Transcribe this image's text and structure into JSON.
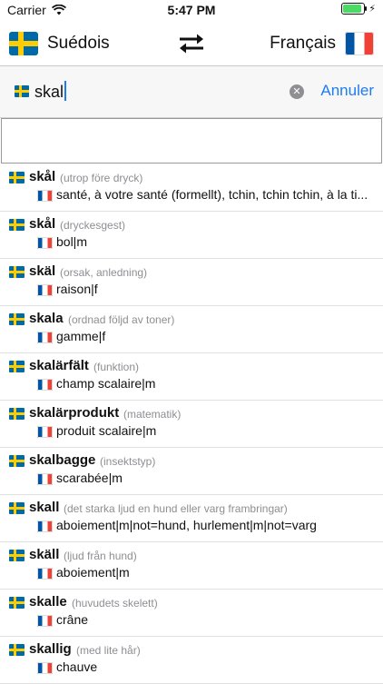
{
  "status_bar": {
    "carrier": "Carrier",
    "time": "5:47 PM",
    "icons": [
      "wifi-icon",
      "battery-icon",
      "charging-icon"
    ]
  },
  "language_bar": {
    "source_language": "Suédois",
    "target_language": "Français",
    "icons": [
      "flag-se-icon",
      "swap-icon",
      "flag-fr-icon"
    ]
  },
  "search": {
    "value": "skal",
    "cancel_label": "Annuler",
    "icons": [
      "flag-se-icon",
      "clear-icon"
    ]
  },
  "results": [
    {
      "word": "skål",
      "note": "(utrop före dryck)",
      "translation": "santé, à votre santé (formellt), tchin, tchin tchin, à la ti..."
    },
    {
      "word": "skål",
      "note": "(dryckesgest)",
      "translation": "bol|m"
    },
    {
      "word": "skäl",
      "note": "(orsak, anledning)",
      "translation": "raison|f"
    },
    {
      "word": "skala",
      "note": "(ordnad följd av toner)",
      "translation": "gamme|f"
    },
    {
      "word": "skalärfält",
      "note": "(funktion)",
      "translation": "champ scalaire|m"
    },
    {
      "word": "skalärprodukt",
      "note": "(matematik)",
      "translation": "produit scalaire|m"
    },
    {
      "word": "skalbagge",
      "note": "(insektstyp)",
      "translation": "scarabée|m"
    },
    {
      "word": "skall",
      "note": "(det starka ljud en hund eller varg frambringar)",
      "translation": "aboiement|m|not=hund, hurlement|m|not=varg"
    },
    {
      "word": "skäll",
      "note": "(ljud från hund)",
      "translation": "aboiement|m"
    },
    {
      "word": "skalle",
      "note": "(huvudets skelett)",
      "translation": "crâne"
    },
    {
      "word": "skallig",
      "note": "(med lite hår)",
      "translation": "chauve"
    }
  ],
  "colors": {
    "accent": "#1e7cf2",
    "secondary_text": "#8e8e93",
    "flag_se_blue": "#006aa7",
    "flag_se_yellow": "#fecc02",
    "flag_fr_blue": "#0055a4",
    "flag_fr_red": "#ef4135"
  }
}
